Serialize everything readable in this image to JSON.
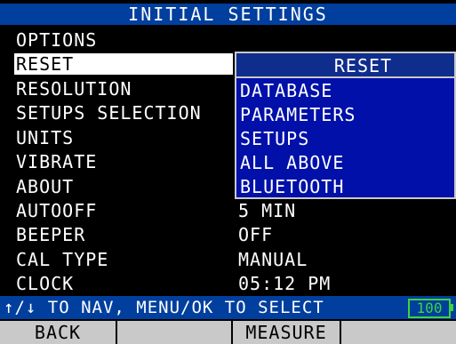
{
  "title": "INITIAL SETTINGS",
  "menu": {
    "items": [
      {
        "label": "OPTIONS",
        "value": ""
      },
      {
        "label": "RESET",
        "value": ""
      },
      {
        "label": "RESOLUTION",
        "value": ""
      },
      {
        "label": "SETUPS SELECTION",
        "value": ""
      },
      {
        "label": "UNITS",
        "value": ""
      },
      {
        "label": "VIBRATE",
        "value": ""
      },
      {
        "label": "ABOUT",
        "value": ""
      },
      {
        "label": "AUTOOFF",
        "value": "5  MIN"
      },
      {
        "label": "BEEPER",
        "value": "OFF"
      },
      {
        "label": "CAL TYPE",
        "value": "MANUAL"
      },
      {
        "label": "CLOCK",
        "value": "05:12 PM"
      }
    ],
    "selected_index": 1
  },
  "popup": {
    "title": "RESET",
    "options": [
      "DATABASE",
      "PARAMETERS",
      "SETUPS",
      "ALL ABOVE",
      "BLUETOOTH"
    ]
  },
  "status": {
    "help_text": "↑/↓ TO NAV, MENU/OK TO SELECT",
    "battery": "100"
  },
  "softkeys": [
    "BACK",
    "",
    "MEASURE",
    ""
  ],
  "colors": {
    "title_bar": "#003f9e",
    "popup_bg": "#0010a8",
    "battery": "#3dd43d"
  }
}
